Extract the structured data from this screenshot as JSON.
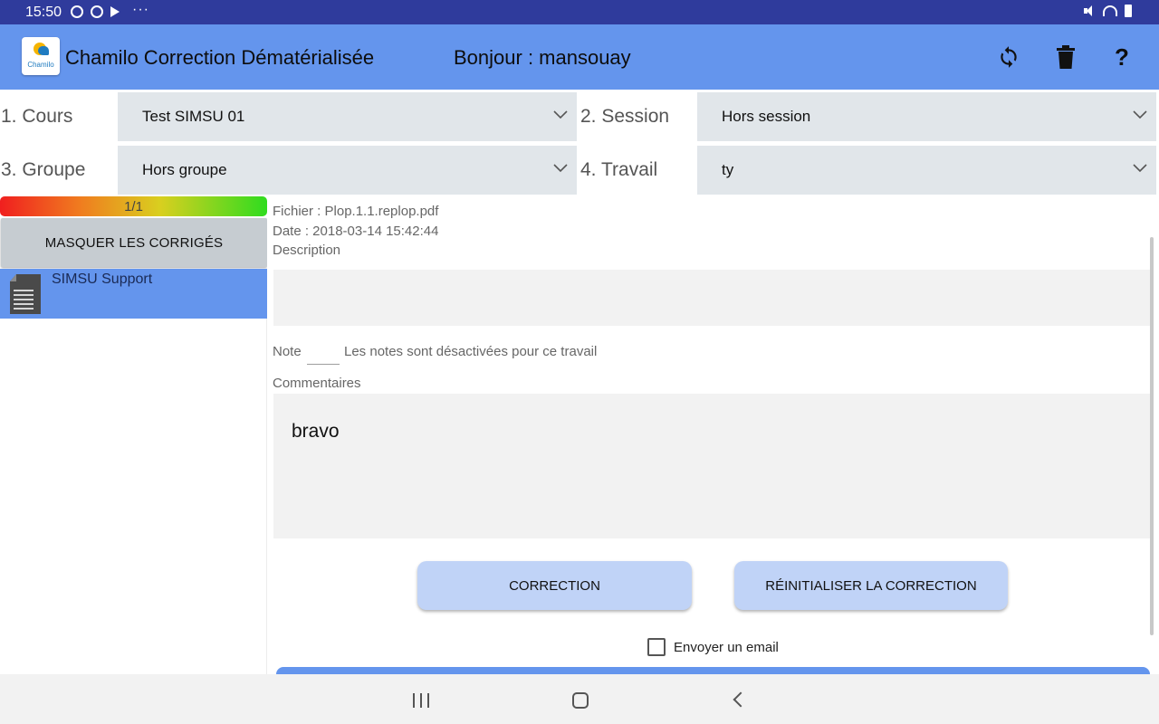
{
  "status_bar": {
    "time": "15:50",
    "dots": "···"
  },
  "app_bar": {
    "title": "Chamilo Correction Dématérialisée",
    "logo_text": "Chamilo",
    "greeting": "Bonjour : mansouay",
    "background": "#6495ed",
    "actions": [
      "sync-icon",
      "delete-icon",
      "help-icon"
    ],
    "help_glyph": "?"
  },
  "selectors": {
    "course": {
      "label": "1. Cours",
      "value": "Test SIMSU 01"
    },
    "session": {
      "label": "2. Session",
      "value": "Hors session"
    },
    "group": {
      "label": "3. Groupe",
      "value": "Hors groupe"
    },
    "work": {
      "label": "4. Travail",
      "value": "ty"
    }
  },
  "left_panel": {
    "progress_text": "1/1",
    "progress_fraction": 1.0,
    "hide_button": "MASQUER LES CORRIGÉS",
    "items": [
      {
        "label": "SIMSU Support",
        "icon": "document-icon",
        "selected": true
      }
    ]
  },
  "detail": {
    "file": "Fichier : Plop.1.1.replop.pdf",
    "date": "Date : 2018-03-14 15:42:44",
    "description_label": "Description",
    "description_value": "",
    "note_label": "Note",
    "note_value": "",
    "note_message": "Les notes sont désactivées pour ce travail",
    "comments_label": "Commentaires",
    "comments_value": "bravo",
    "correction_button": "CORRECTION",
    "reset_button": "RÉINITIALISER LA CORRECTION",
    "send_email_label": "Envoyer un email",
    "send_email_checked": false
  },
  "colors": {
    "status_bar": "#2f3b9c",
    "selected_item": "#6495ed",
    "action_button": "#c0d3f7"
  }
}
